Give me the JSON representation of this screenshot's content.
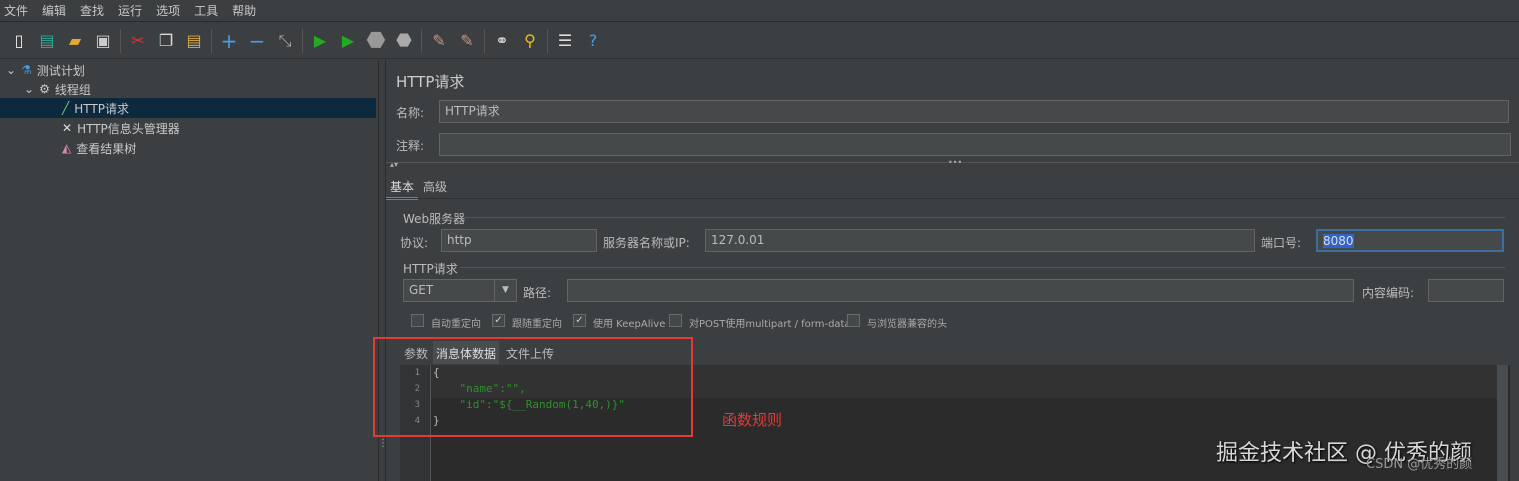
{
  "menu": [
    "文件",
    "编辑",
    "查找",
    "运行",
    "选项",
    "工具",
    "帮助"
  ],
  "toolbar": {
    "icons": [
      "new-icon",
      "templates-icon",
      "open-icon",
      "save-icon",
      "cut-icon",
      "copy-icon",
      "paste-icon",
      "expand-icon",
      "collapse-icon",
      "toggle-icon",
      "start-icon",
      "start-no-pause-icon",
      "stop-icon",
      "shutdown-icon",
      "clear-icon",
      "clear-all-icon",
      "search-icon",
      "reset-search-icon",
      "function-helper-icon",
      "help-icon"
    ]
  },
  "tree": {
    "items": [
      {
        "label": "测试计划"
      },
      {
        "label": "线程组"
      },
      {
        "label": "HTTP请求"
      },
      {
        "label": "HTTP信息头管理器"
      },
      {
        "label": "查看结果树"
      }
    ]
  },
  "panel": {
    "title": "HTTP请求",
    "name_label": "名称:",
    "name_value": "HTTP请求",
    "comment_label": "注释:",
    "comment_value": "",
    "tabs": [
      "基本",
      "高级"
    ],
    "web_server": {
      "legend": "Web服务器",
      "protocol_label": "协议:",
      "protocol_value": "http",
      "server_label": "服务器名称或IP:",
      "server_value": "127.0.01",
      "port_label": "端口号:",
      "port_value": "8080"
    },
    "http_request": {
      "legend": "HTTP请求",
      "method": "GET",
      "path_label": "路径:",
      "path_value": "",
      "encoding_label": "内容编码:",
      "encoding_value": ""
    },
    "checkboxes": [
      {
        "label": "自动重定向",
        "checked": false
      },
      {
        "label": "跟随重定向",
        "checked": true
      },
      {
        "label": "使用 KeepAlive",
        "checked": true
      },
      {
        "label": "对POST使用multipart / form-data",
        "checked": false
      },
      {
        "label": "与浏览器兼容的头",
        "checked": false
      }
    ],
    "subtabs": [
      "参数",
      "消息体数据",
      "文件上传"
    ],
    "body_lines": [
      {
        "n": "1",
        "text": "{"
      },
      {
        "n": "2",
        "text": "    \"name\":\"\","
      },
      {
        "n": "3",
        "text": "    \"id\":\"${__Random(1,40,)}\""
      },
      {
        "n": "4",
        "text": "}"
      }
    ]
  },
  "annotation": {
    "text": "函数规则",
    "color": "#e53935"
  },
  "watermark": {
    "main": "掘金技术社区 @ 优秀的颜",
    "sub": "CSDN @优秀的颜"
  }
}
